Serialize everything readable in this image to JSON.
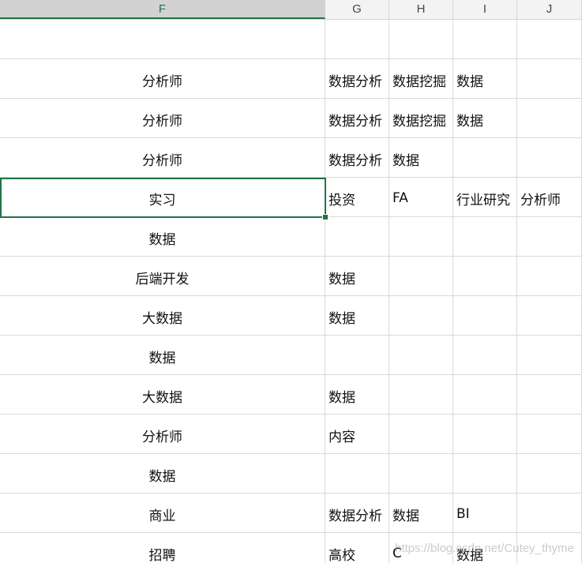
{
  "columns": [
    "F",
    "G",
    "H",
    "I",
    "J"
  ],
  "rows": [
    [
      "",
      "",
      "",
      "",
      ""
    ],
    [
      "分析师",
      "数据分析",
      "数据挖掘",
      "数据",
      ""
    ],
    [
      "分析师",
      "数据分析",
      "数据挖掘",
      "数据",
      ""
    ],
    [
      "分析师",
      "数据分析",
      "数据",
      "",
      ""
    ],
    [
      "实习",
      "投资",
      "FA",
      "行业研究",
      "分析师"
    ],
    [
      "数据",
      "",
      "",
      "",
      ""
    ],
    [
      "后端开发",
      "数据",
      "",
      "",
      ""
    ],
    [
      "大数据",
      "数据",
      "",
      "",
      ""
    ],
    [
      "数据",
      "",
      "",
      "",
      ""
    ],
    [
      "大数据",
      "数据",
      "",
      "",
      ""
    ],
    [
      "分析师",
      "内容",
      "",
      "",
      ""
    ],
    [
      "数据",
      "",
      "",
      "",
      ""
    ],
    [
      "商业",
      "数据分析",
      "数据",
      "BI",
      ""
    ],
    [
      "招聘",
      "高校",
      "C",
      "数据",
      ""
    ]
  ],
  "watermark": "https://blog.csdn.net/Cutey_thyme",
  "colors": {
    "selection": "#217346",
    "gridline": "#d9d9d9",
    "header_bg": "#f3f3f3"
  }
}
